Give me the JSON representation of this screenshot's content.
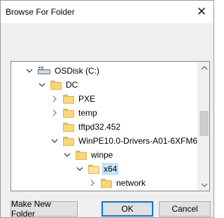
{
  "window": {
    "title": "Browse For Folder",
    "close_glyph": "✕"
  },
  "tree": {
    "nodes": [
      {
        "label": "OSDisk (C:)",
        "expander": "expanded",
        "icon": "drive-icon"
      },
      {
        "label": "DC",
        "expander": "expanded",
        "icon": "folder-icon"
      },
      {
        "label": "PXE",
        "expander": "collapsed",
        "icon": "folder-icon"
      },
      {
        "label": "temp",
        "expander": "collapsed",
        "icon": "folder-icon"
      },
      {
        "label": "tftpd32.452",
        "expander": "none",
        "icon": "folder-icon"
      },
      {
        "label": "WinPE10.0-Drivers-A01-6XFM6",
        "expander": "expanded",
        "icon": "folder-icon"
      },
      {
        "label": "winpe",
        "expander": "expanded",
        "icon": "folder-icon"
      },
      {
        "label": "x64",
        "expander": "expanded",
        "icon": "folder-icon",
        "selected": true
      },
      {
        "label": "network",
        "expander": "collapsed",
        "icon": "folder-icon"
      }
    ],
    "selection_color": "#cce8ff"
  },
  "buttons": {
    "make_new_folder": "Make New Folder",
    "ok": "OK",
    "cancel": "Cancel"
  },
  "colors": {
    "folder": "#f8d775",
    "accent": "#0078d7"
  }
}
